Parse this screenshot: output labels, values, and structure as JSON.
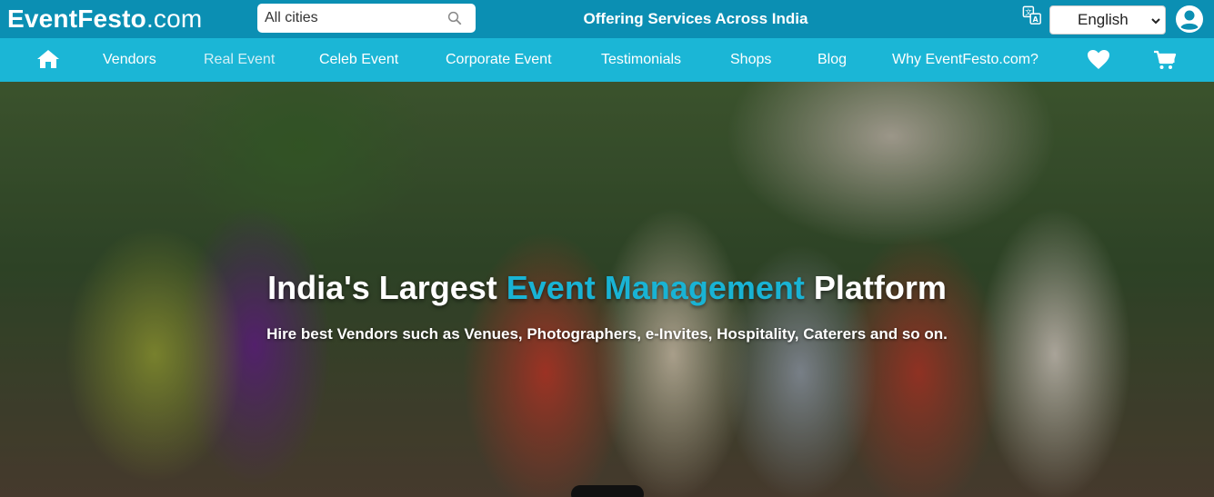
{
  "site": {
    "logo_main": "EventFesto",
    "logo_suffix": ".com"
  },
  "search": {
    "placeholder": "All cities",
    "icon": "search-icon"
  },
  "header": {
    "tagline": "Offering Services Across India"
  },
  "language": {
    "selected": "English",
    "icon": "translate-icon"
  },
  "nav": {
    "items": [
      {
        "label": "Vendors"
      },
      {
        "label": "Real Event"
      },
      {
        "label": "Celeb Event"
      },
      {
        "label": "Corporate Event"
      },
      {
        "label": "Testimonials"
      },
      {
        "label": "Shops"
      },
      {
        "label": "Blog"
      },
      {
        "label": "Why EventFesto.com?"
      }
    ],
    "active": "Real Event"
  },
  "hero": {
    "headline_pre": "India's Largest ",
    "headline_highlight": "Event Management",
    "headline_post": " Platform",
    "subheadline": "Hire best Vendors such as Venues, Photographers, e-Invites, Hospitality, Caterers and so on."
  },
  "colors": {
    "topbar": "#0b8fb3",
    "navbar": "#1bb6d6",
    "highlight": "#19b3d4"
  }
}
